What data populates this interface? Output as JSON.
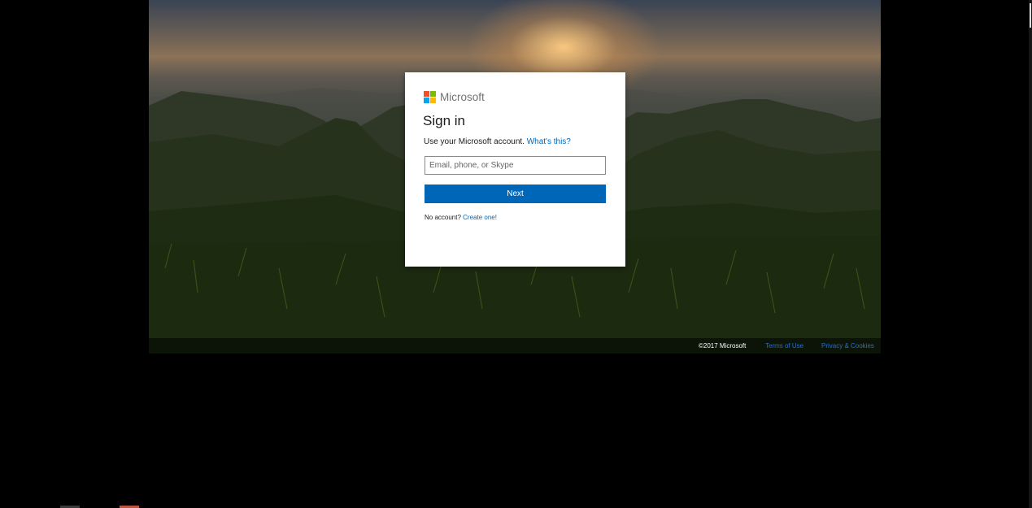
{
  "brand": {
    "logo_text": "Microsoft",
    "colors": {
      "red": "#f25022",
      "green": "#7fba00",
      "blue": "#00a4ef",
      "yellow": "#ffb900"
    }
  },
  "signin": {
    "title": "Sign in",
    "subtitle": "Use your Microsoft account.",
    "whats_this": "What's this?",
    "email_placeholder": "Email, phone, or Skype",
    "email_value": "",
    "next_label": "Next",
    "no_account": "No account?",
    "create_link": "Create one!"
  },
  "footer": {
    "copyright": "©2017 Microsoft",
    "terms": "Terms of Use",
    "privacy": "Privacy & Cookies"
  },
  "theme": {
    "accent": "#0067b8",
    "background": "#000000"
  }
}
